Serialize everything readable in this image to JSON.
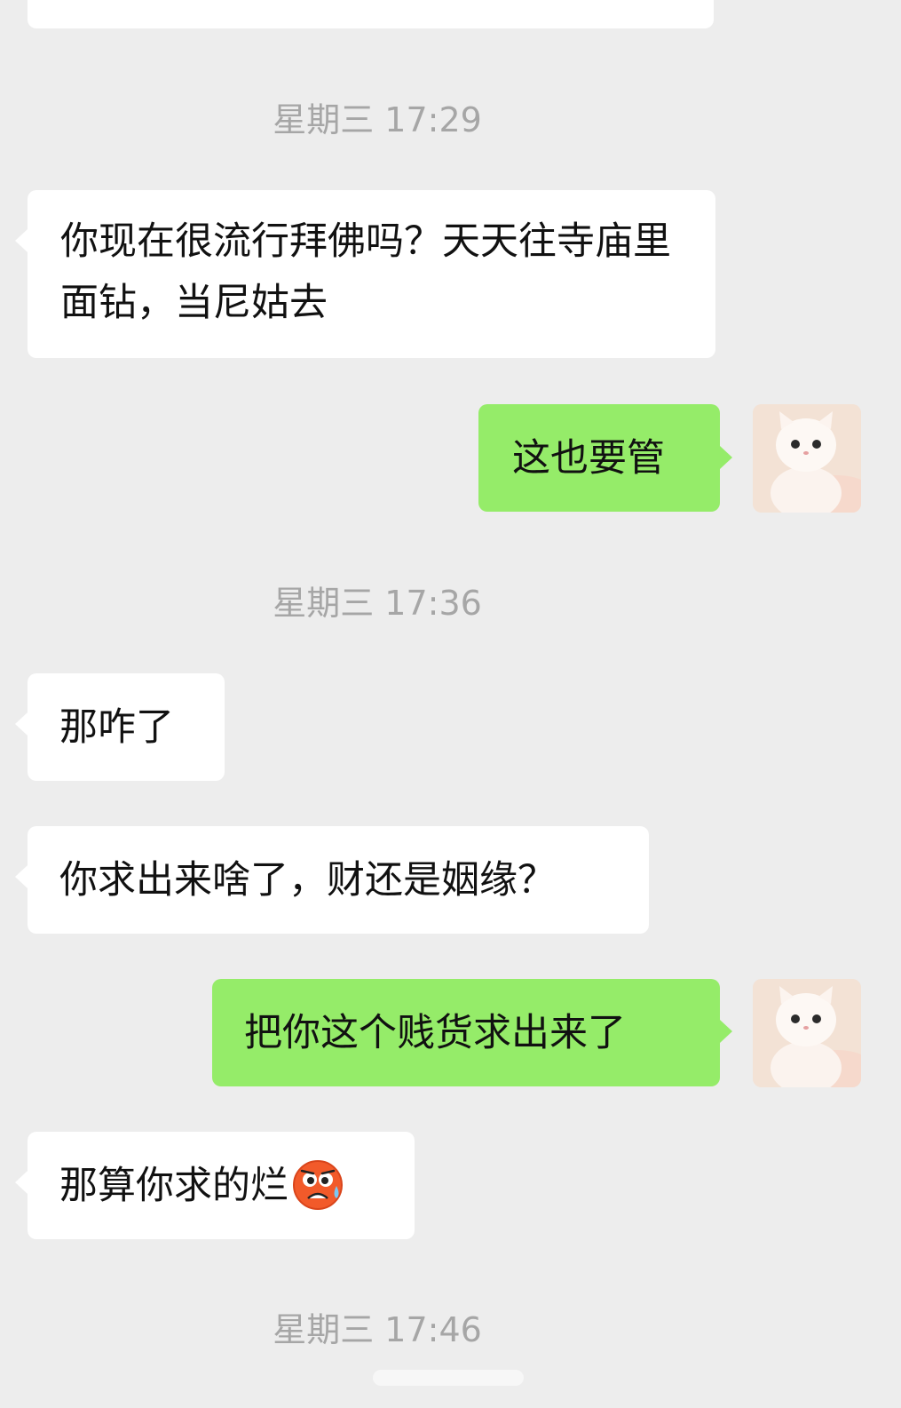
{
  "messages": [
    {
      "type": "timestamp",
      "text": "星期三 17:29"
    },
    {
      "type": "received",
      "text": "你现在很流行拜佛吗？天天往寺庙里面钻，当尼姑去"
    },
    {
      "type": "sent",
      "text": "这也要管"
    },
    {
      "type": "timestamp",
      "text": "星期三 17:36"
    },
    {
      "type": "received",
      "text": "那咋了"
    },
    {
      "type": "received",
      "text": "你求出来啥了，财还是姻缘？"
    },
    {
      "type": "sent",
      "text": "把你这个贱货求出来了"
    },
    {
      "type": "received",
      "text": "那算你求的烂",
      "emoji": "worried-sweat-emoji"
    },
    {
      "type": "timestamp",
      "text": "星期三 17:46"
    }
  ],
  "colors": {
    "background": "#ededed",
    "received_bubble": "#ffffff",
    "sent_bubble": "#95ec69",
    "timestamp_text": "#a6a6a6"
  },
  "avatar": {
    "icon": "white-kitten-avatar"
  }
}
